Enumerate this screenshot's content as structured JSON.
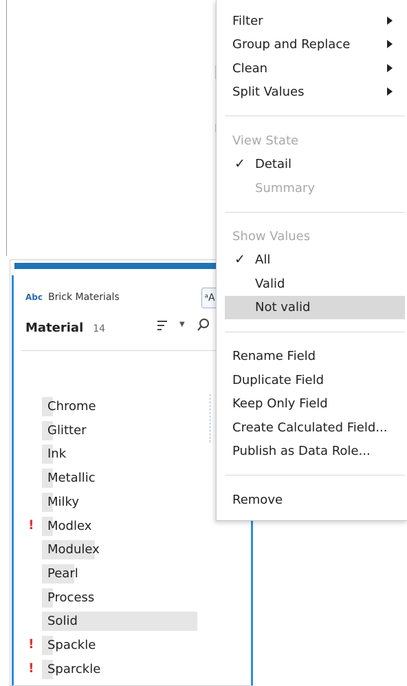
{
  "card": {
    "type_icon": "Abc",
    "source_name": "Brick Materials",
    "hint_glyph": "ᵃA",
    "field_name": "Material",
    "field_count": "14",
    "values": [
      {
        "label": "Chrome",
        "invalid": false,
        "bar_pct": 5
      },
      {
        "label": "Glitter",
        "invalid": false,
        "bar_pct": 5
      },
      {
        "label": "Ink",
        "invalid": false,
        "bar_pct": 5
      },
      {
        "label": "Metallic",
        "invalid": false,
        "bar_pct": 5
      },
      {
        "label": "Milky",
        "invalid": false,
        "bar_pct": 5
      },
      {
        "label": "Modlex",
        "invalid": true,
        "bar_pct": 5
      },
      {
        "label": "Modulex",
        "invalid": false,
        "bar_pct": 34
      },
      {
        "label": "Pearl",
        "invalid": false,
        "bar_pct": 21
      },
      {
        "label": "Process",
        "invalid": false,
        "bar_pct": 5
      },
      {
        "label": "Solid",
        "invalid": false,
        "bar_pct": 100
      },
      {
        "label": "Spackle",
        "invalid": true,
        "bar_pct": 5
      },
      {
        "label": "Sparckle",
        "invalid": true,
        "bar_pct": 5
      }
    ]
  },
  "menu": {
    "submenus": [
      {
        "label": "Filter"
      },
      {
        "label": "Group and Replace"
      },
      {
        "label": "Clean"
      },
      {
        "label": "Split Values"
      }
    ],
    "view_state": {
      "header": "View State",
      "options": [
        {
          "label": "Detail",
          "checked": true,
          "enabled": true
        },
        {
          "label": "Summary",
          "checked": false,
          "enabled": false
        }
      ]
    },
    "show_values": {
      "header": "Show Values",
      "options": [
        {
          "label": "All",
          "checked": true,
          "highlighted": false
        },
        {
          "label": "Valid",
          "checked": false,
          "highlighted": false
        },
        {
          "label": "Not valid",
          "checked": false,
          "highlighted": true
        }
      ]
    },
    "field_actions": [
      {
        "label": "Rename Field"
      },
      {
        "label": "Duplicate Field"
      },
      {
        "label": "Keep Only Field"
      },
      {
        "label": "Create Calculated Field..."
      },
      {
        "label": "Publish as Data Role..."
      }
    ],
    "remove": {
      "label": "Remove"
    }
  },
  "colors": {
    "accent_blue": "#2d8ae0",
    "invalid_red": "#e0342f",
    "hover_gray": "#d9d9d9",
    "disabled_text": "#a9a9a9"
  },
  "icons": [
    "sort-icon",
    "chevron-down-icon",
    "search-icon",
    "submenu-arrow-icon",
    "checkmark-icon",
    "invalid-exclamation-icon"
  ]
}
